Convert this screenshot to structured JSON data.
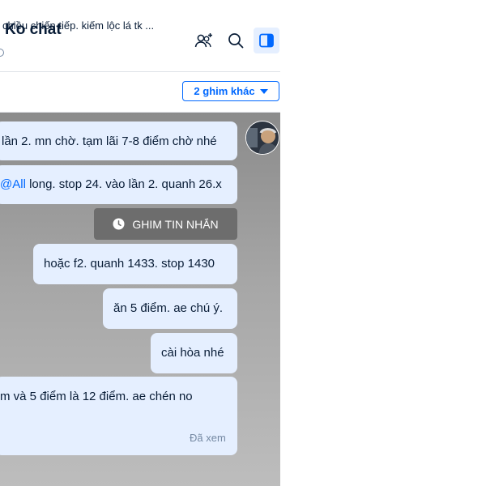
{
  "header": {
    "title": "Ko chat",
    "icons": [
      "add-member-icon",
      "search-icon",
      "sidebar-toggle-icon"
    ]
  },
  "pinned": {
    "text": "chiều chiến tiếp. kiếm lộc lá tk ...",
    "more_label": "2 ghim khác"
  },
  "messages": [
    {
      "text": "lần 2. mn chờ. tạm lãi 7-8 điểm chờ nhé"
    },
    {
      "mention": "@All",
      "text": " long. stop 24. vào lần 2. quanh 26.x"
    },
    {
      "text": "hoặc  f2. quanh 1433. stop 1430"
    },
    {
      "text": "ăn 5 điểm. ae chú ý."
    },
    {
      "text": "cài hòa nhé"
    },
    {
      "text": "m và 5 điểm là 12 điểm. ae chén no"
    }
  ],
  "system_notice": "GHIM TIN NHẮN",
  "seen_status": "Đã xem",
  "colors": {
    "accent": "#0068ff",
    "bubble": "#e5efff",
    "text": "#081c36",
    "muted": "#7589a3"
  }
}
